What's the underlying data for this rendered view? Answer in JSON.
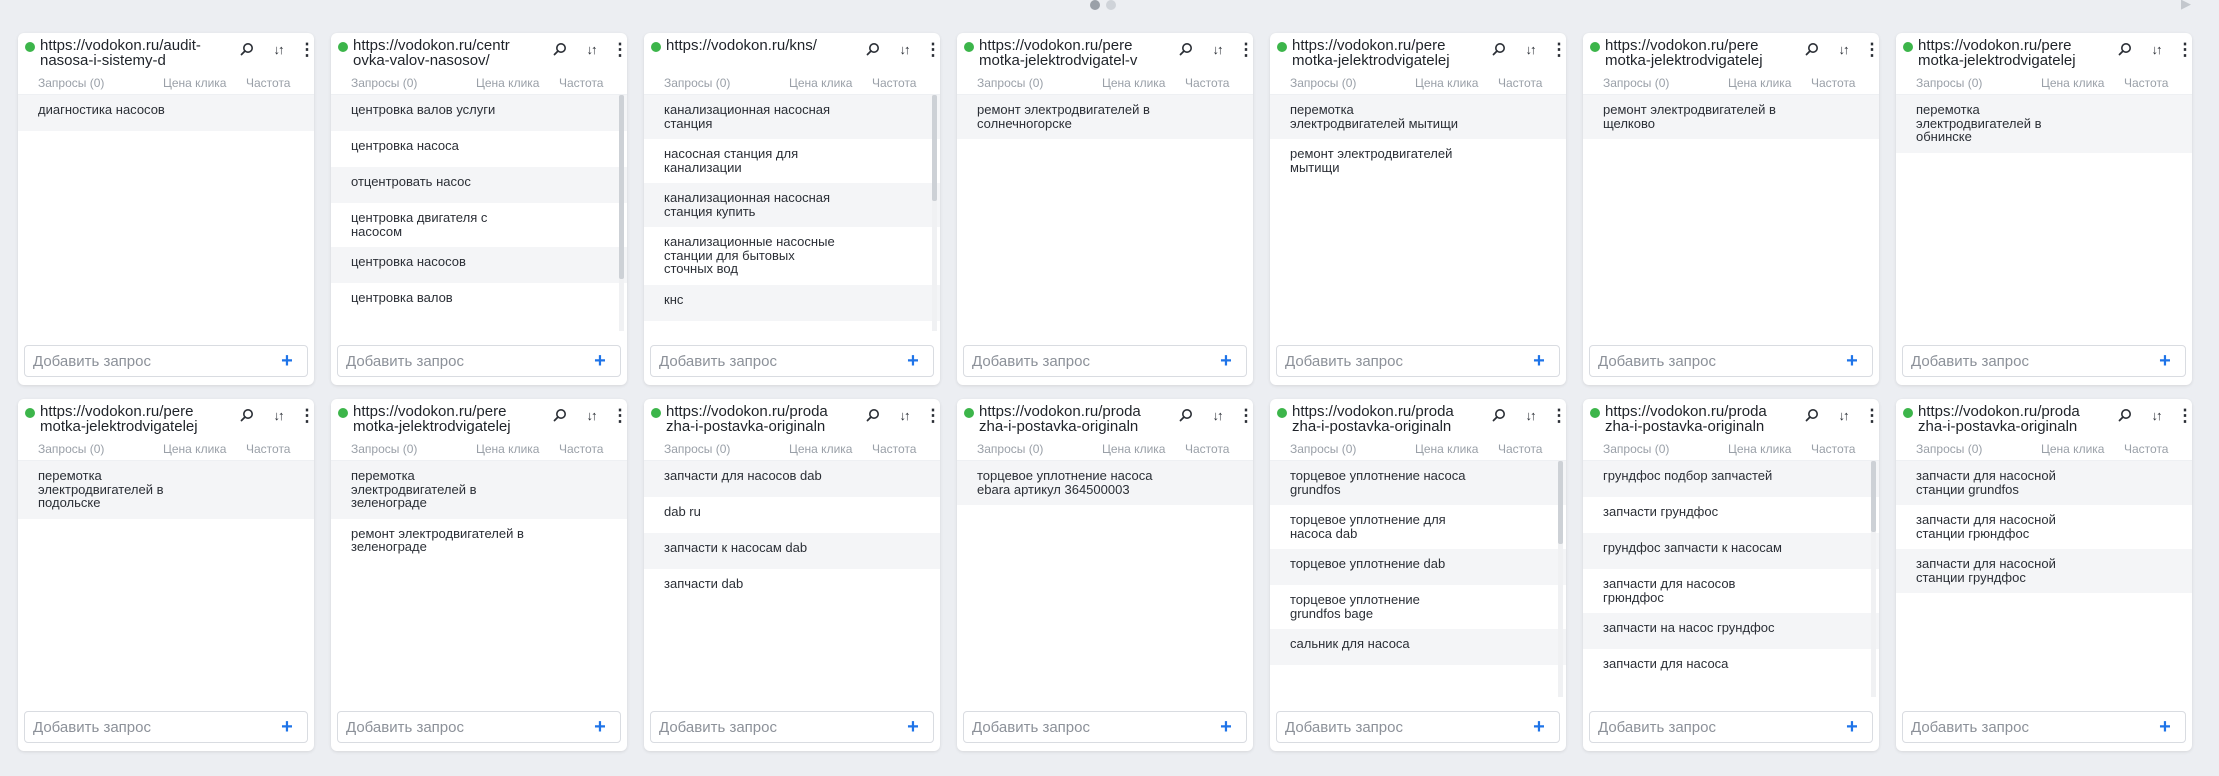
{
  "labels": {
    "requests": "Запросы (0)",
    "click_price": "Цена клика",
    "frequency": "Частота",
    "add_placeholder": "Добавить запрос"
  },
  "colors": {
    "status": "#3cb54a",
    "accent": "#1f74e8"
  },
  "icons": {
    "search": "search-icon",
    "sort": "sort-icon",
    "more": "more-vertical-icon",
    "add": "plus-icon",
    "status": "status-dot-icon"
  },
  "cards": [
    {
      "url": "https://vodokon.ru/audit-nasosa-i-sistemy-d",
      "scroll": null,
      "keywords": [
        "диагностика насосов"
      ]
    },
    {
      "url": "https://vodokon.ru/centrovka-valov-nasosov/",
      "scroll": 0.78,
      "keywords": [
        "центровка валов услуги",
        "центровка насоса",
        "отцентровать насос",
        "центровка двигателя с насосом",
        "центровка насосов",
        "центровка валов"
      ]
    },
    {
      "url": "https://vodokon.ru/kns/",
      "scroll": 0.45,
      "keywords": [
        "канализационная насосная станция",
        "насосная станция для канализации",
        "канализационная насосная станция купить",
        "канализационные насосные станции для бытовых сточных вод",
        "кнс"
      ]
    },
    {
      "url": "https://vodokon.ru/peremotka-jelektrodvigatel-v-s",
      "scroll": null,
      "keywords": [
        "ремонт электродвигателей в солнечногорске"
      ]
    },
    {
      "url": "https://vodokon.ru/peremotka-jelektrodvigatelej-mytishhi",
      "scroll": null,
      "keywords": [
        "перемотка электродвигателей мытищи",
        "ремонт электродвигателей мытищи"
      ]
    },
    {
      "url": "https://vodokon.ru/peremotka-jelektrodvigatelej-shhelkovo",
      "scroll": null,
      "keywords": [
        "ремонт электродвигателей в щелково"
      ]
    },
    {
      "url": "https://vodokon.ru/peremotka-jelektrodvigatelej-v-obninske",
      "scroll": null,
      "keywords": [
        "перемотка электродвигателей в обнинске"
      ]
    },
    {
      "url": "https://vodokon.ru/peremotka-jelektrodvigatelej-v-podolske",
      "scroll": null,
      "keywords": [
        "перемотка электродвигателей в подольске"
      ]
    },
    {
      "url": "https://vodokon.ru/peremotka-jelektrodvigatelej-v-zelenograde",
      "scroll": null,
      "keywords": [
        "перемотка электродвигателей в зеленограде",
        "ремонт электродвигателей в зеленограде"
      ]
    },
    {
      "url": "https://vodokon.ru/prodazha-i-postavka-originalnyh-z",
      "scroll": null,
      "keywords": [
        "запчасти для насосов dab",
        "dab ru",
        "запчасти к насосам dab",
        "запчасти dab"
      ]
    },
    {
      "url": "https://vodokon.ru/prodazha-i-postavka-originalnyh-z",
      "scroll": null,
      "keywords": [
        "торцевое уплотнение насоса ebara артикул 364500003"
      ]
    },
    {
      "url": "https://vodokon.ru/prodazha-i-postavka-originalnyh-z",
      "scroll": 0.35,
      "keywords": [
        "торцевое уплотнение насоса grundfos",
        "торцевое уплотнение для насоса dab",
        "торцевое уплотнение dab",
        "торцевое уплотнение grundfos bage",
        "сальник для насоса"
      ]
    },
    {
      "url": "https://vodokon.ru/prodazha-i-postavka-originalnyh-z",
      "scroll": 0.3,
      "keywords": [
        "грундфос подбор запчастей",
        "запчасти грундфос",
        "грундфос запчасти к насосам",
        "запчасти для насосов грюндфос",
        "запчасти на насос грундфос",
        "запчасти для насоса"
      ]
    },
    {
      "url": "https://vodokon.ru/prodazha-i-postavka-originalnyh-z",
      "scroll": null,
      "keywords": [
        "запчасти для насосной станции grundfos",
        "запчасти для насосной станции грюндфос",
        "запчасти для насосной станции грундфос"
      ]
    }
  ]
}
